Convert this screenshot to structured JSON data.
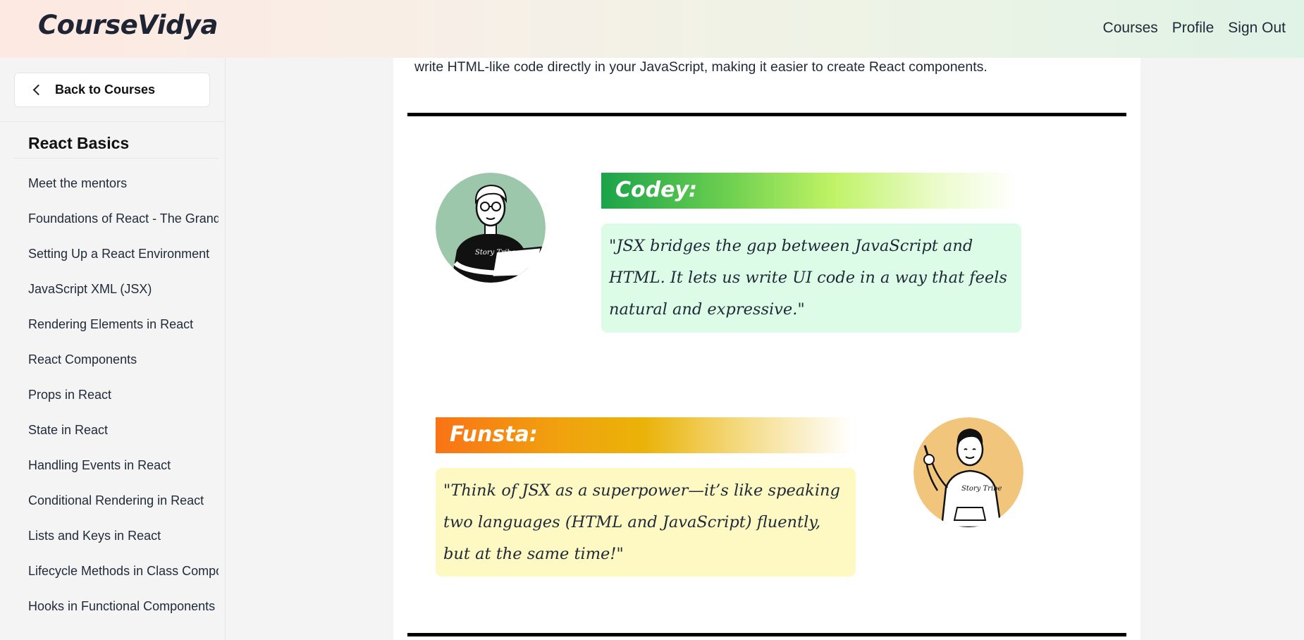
{
  "header": {
    "logo": "CourseVidya",
    "nav": [
      "Courses",
      "Profile",
      "Sign Out"
    ]
  },
  "sidebar": {
    "back_label": "Back to Courses",
    "back_icon": "chevron-left-icon",
    "module_title": "React Basics",
    "lessons": [
      "Meet the mentors",
      "Foundations of React - The Grand Tour",
      "Setting Up a React Environment",
      "JavaScript XML (JSX)",
      "Rendering Elements in React",
      "React Components",
      "Props in React",
      "State in React",
      "Handling Events in React",
      "Conditional Rendering in React",
      "Lists and Keys in React",
      "Lifecycle Methods in Class Components",
      "Hooks in Functional Components"
    ]
  },
  "content": {
    "intro_text": "write HTML-like code directly in your JavaScript, making it easier to create React components.",
    "dialogues": [
      {
        "speaker": "Codey:",
        "quote": "\"JSX bridges the gap between JavaScript and HTML. It lets us write UI code in a way that feels natural and expressive.\"",
        "avatar_shirt_text": "Story Tribe",
        "colors": {
          "avatar_bg": "#9cc7aa",
          "banner_start": "#1aa34a",
          "banner_mid": "#bef264",
          "quote_bg": "#dcfce7"
        }
      },
      {
        "speaker": "Funsta:",
        "quote": "\"Think of JSX as a superpower—it’s like speaking two languages (HTML and JavaScript) fluently, but at the same time!\"",
        "avatar_shirt_text": "Story Tribe",
        "colors": {
          "avatar_bg": "#f2c57c",
          "banner_start": "#f97316",
          "banner_mid": "#eab308",
          "quote_bg": "#fef9c3"
        }
      }
    ]
  }
}
